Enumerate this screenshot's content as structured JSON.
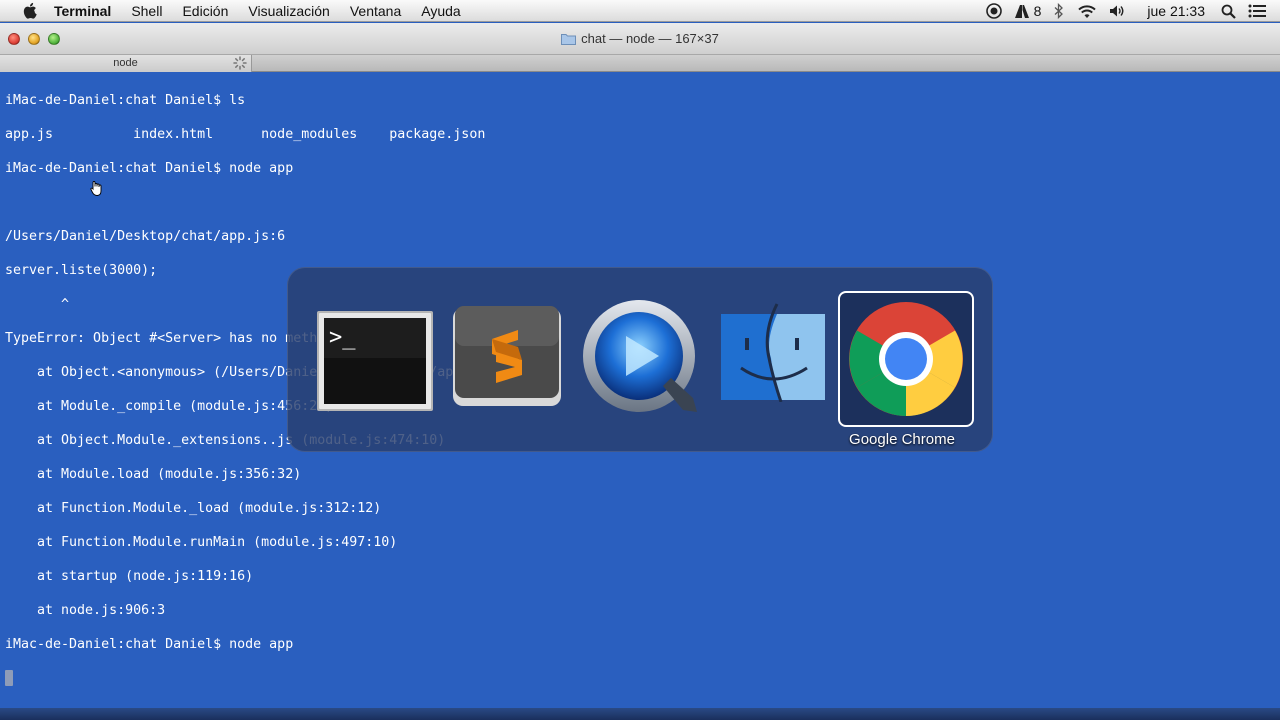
{
  "menubar": {
    "items": [
      "Terminal",
      "Shell",
      "Edición",
      "Visualización",
      "Ventana",
      "Ayuda"
    ],
    "status": {
      "adobe_count": "8",
      "clock": "jue 21:33"
    },
    "icons": [
      "apple-icon",
      "record-icon",
      "adobe-icon",
      "bluetooth-icon",
      "wifi-icon",
      "volume-icon",
      "spotlight-icon",
      "notification-list-icon"
    ]
  },
  "window": {
    "title": "chat — node — 167×37",
    "tab_label": "node"
  },
  "terminal": {
    "lines": [
      "iMac-de-Daniel:chat Daniel$ ls",
      "app.js          index.html      node_modules    package.json",
      "iMac-de-Daniel:chat Daniel$ node app",
      "",
      "/Users/Daniel/Desktop/chat/app.js:6",
      "server.liste(3000);",
      "       ^",
      "TypeError: Object #<Server> has no method 'liste'",
      "    at Object.<anonymous> (/Users/Daniel/Desktop/chat/app.js:6:8)",
      "    at Module._compile (module.js:456:26)",
      "    at Object.Module._extensions..js (module.js:474:10)",
      "    at Module.load (module.js:356:32)",
      "    at Function.Module._load (module.js:312:12)",
      "    at Function.Module.runMain (module.js:497:10)",
      "    at startup (node.js:119:16)",
      "    at node.js:906:3",
      "iMac-de-Daniel:chat Daniel$ node app"
    ]
  },
  "switcher": {
    "apps": [
      "Terminal",
      "Sublime Text",
      "QuickTime Player",
      "Finder",
      "Google Chrome"
    ],
    "selected_label": "Google Chrome"
  },
  "colors": {
    "terminal_bg": "#2a5fbf",
    "switcher_bg": "#283e6e"
  }
}
